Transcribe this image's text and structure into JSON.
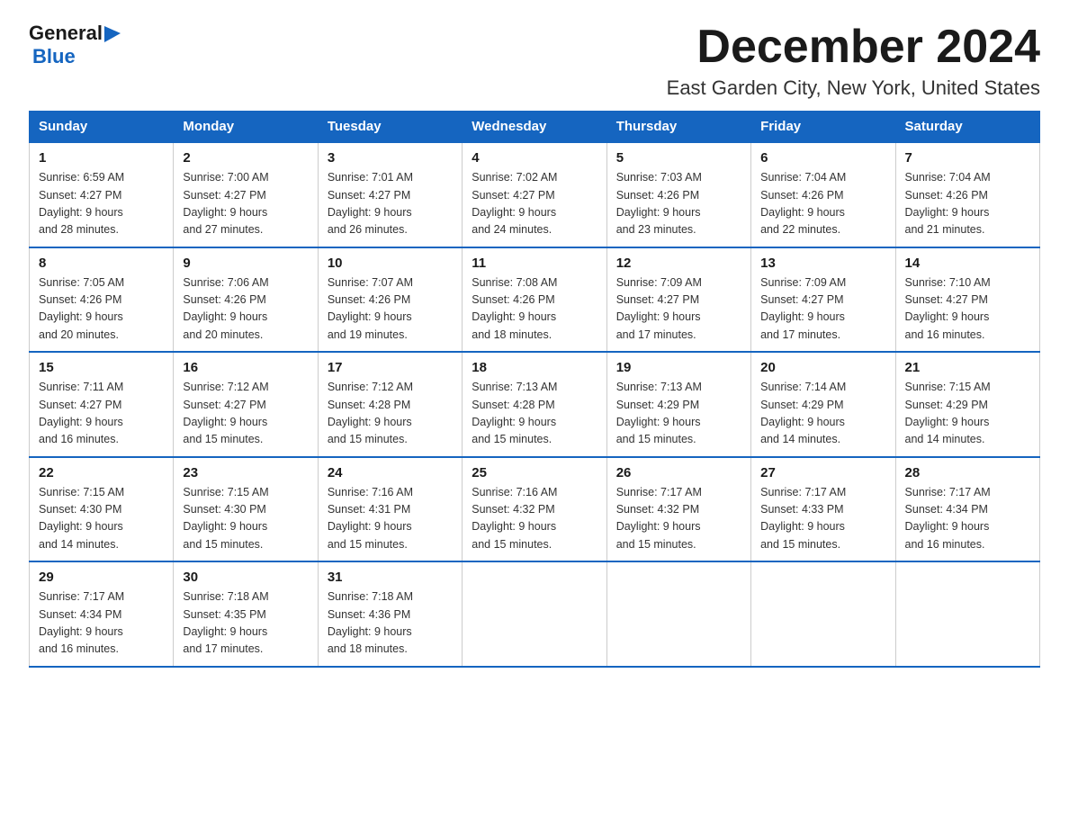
{
  "header": {
    "logo_general": "General",
    "logo_blue": "Blue",
    "title": "December 2024",
    "subtitle": "East Garden City, New York, United States"
  },
  "days_of_week": [
    "Sunday",
    "Monday",
    "Tuesday",
    "Wednesday",
    "Thursday",
    "Friday",
    "Saturday"
  ],
  "weeks": [
    [
      {
        "day": "1",
        "sunrise": "6:59 AM",
        "sunset": "4:27 PM",
        "daylight": "9 hours and 28 minutes."
      },
      {
        "day": "2",
        "sunrise": "7:00 AM",
        "sunset": "4:27 PM",
        "daylight": "9 hours and 27 minutes."
      },
      {
        "day": "3",
        "sunrise": "7:01 AM",
        "sunset": "4:27 PM",
        "daylight": "9 hours and 26 minutes."
      },
      {
        "day": "4",
        "sunrise": "7:02 AM",
        "sunset": "4:27 PM",
        "daylight": "9 hours and 24 minutes."
      },
      {
        "day": "5",
        "sunrise": "7:03 AM",
        "sunset": "4:26 PM",
        "daylight": "9 hours and 23 minutes."
      },
      {
        "day": "6",
        "sunrise": "7:04 AM",
        "sunset": "4:26 PM",
        "daylight": "9 hours and 22 minutes."
      },
      {
        "day": "7",
        "sunrise": "7:04 AM",
        "sunset": "4:26 PM",
        "daylight": "9 hours and 21 minutes."
      }
    ],
    [
      {
        "day": "8",
        "sunrise": "7:05 AM",
        "sunset": "4:26 PM",
        "daylight": "9 hours and 20 minutes."
      },
      {
        "day": "9",
        "sunrise": "7:06 AM",
        "sunset": "4:26 PM",
        "daylight": "9 hours and 20 minutes."
      },
      {
        "day": "10",
        "sunrise": "7:07 AM",
        "sunset": "4:26 PM",
        "daylight": "9 hours and 19 minutes."
      },
      {
        "day": "11",
        "sunrise": "7:08 AM",
        "sunset": "4:26 PM",
        "daylight": "9 hours and 18 minutes."
      },
      {
        "day": "12",
        "sunrise": "7:09 AM",
        "sunset": "4:27 PM",
        "daylight": "9 hours and 17 minutes."
      },
      {
        "day": "13",
        "sunrise": "7:09 AM",
        "sunset": "4:27 PM",
        "daylight": "9 hours and 17 minutes."
      },
      {
        "day": "14",
        "sunrise": "7:10 AM",
        "sunset": "4:27 PM",
        "daylight": "9 hours and 16 minutes."
      }
    ],
    [
      {
        "day": "15",
        "sunrise": "7:11 AM",
        "sunset": "4:27 PM",
        "daylight": "9 hours and 16 minutes."
      },
      {
        "day": "16",
        "sunrise": "7:12 AM",
        "sunset": "4:27 PM",
        "daylight": "9 hours and 15 minutes."
      },
      {
        "day": "17",
        "sunrise": "7:12 AM",
        "sunset": "4:28 PM",
        "daylight": "9 hours and 15 minutes."
      },
      {
        "day": "18",
        "sunrise": "7:13 AM",
        "sunset": "4:28 PM",
        "daylight": "9 hours and 15 minutes."
      },
      {
        "day": "19",
        "sunrise": "7:13 AM",
        "sunset": "4:29 PM",
        "daylight": "9 hours and 15 minutes."
      },
      {
        "day": "20",
        "sunrise": "7:14 AM",
        "sunset": "4:29 PM",
        "daylight": "9 hours and 14 minutes."
      },
      {
        "day": "21",
        "sunrise": "7:15 AM",
        "sunset": "4:29 PM",
        "daylight": "9 hours and 14 minutes."
      }
    ],
    [
      {
        "day": "22",
        "sunrise": "7:15 AM",
        "sunset": "4:30 PM",
        "daylight": "9 hours and 14 minutes."
      },
      {
        "day": "23",
        "sunrise": "7:15 AM",
        "sunset": "4:30 PM",
        "daylight": "9 hours and 15 minutes."
      },
      {
        "day": "24",
        "sunrise": "7:16 AM",
        "sunset": "4:31 PM",
        "daylight": "9 hours and 15 minutes."
      },
      {
        "day": "25",
        "sunrise": "7:16 AM",
        "sunset": "4:32 PM",
        "daylight": "9 hours and 15 minutes."
      },
      {
        "day": "26",
        "sunrise": "7:17 AM",
        "sunset": "4:32 PM",
        "daylight": "9 hours and 15 minutes."
      },
      {
        "day": "27",
        "sunrise": "7:17 AM",
        "sunset": "4:33 PM",
        "daylight": "9 hours and 15 minutes."
      },
      {
        "day": "28",
        "sunrise": "7:17 AM",
        "sunset": "4:34 PM",
        "daylight": "9 hours and 16 minutes."
      }
    ],
    [
      {
        "day": "29",
        "sunrise": "7:17 AM",
        "sunset": "4:34 PM",
        "daylight": "9 hours and 16 minutes."
      },
      {
        "day": "30",
        "sunrise": "7:18 AM",
        "sunset": "4:35 PM",
        "daylight": "9 hours and 17 minutes."
      },
      {
        "day": "31",
        "sunrise": "7:18 AM",
        "sunset": "4:36 PM",
        "daylight": "9 hours and 18 minutes."
      },
      null,
      null,
      null,
      null
    ]
  ],
  "labels": {
    "sunrise": "Sunrise:",
    "sunset": "Sunset:",
    "daylight": "Daylight:"
  }
}
